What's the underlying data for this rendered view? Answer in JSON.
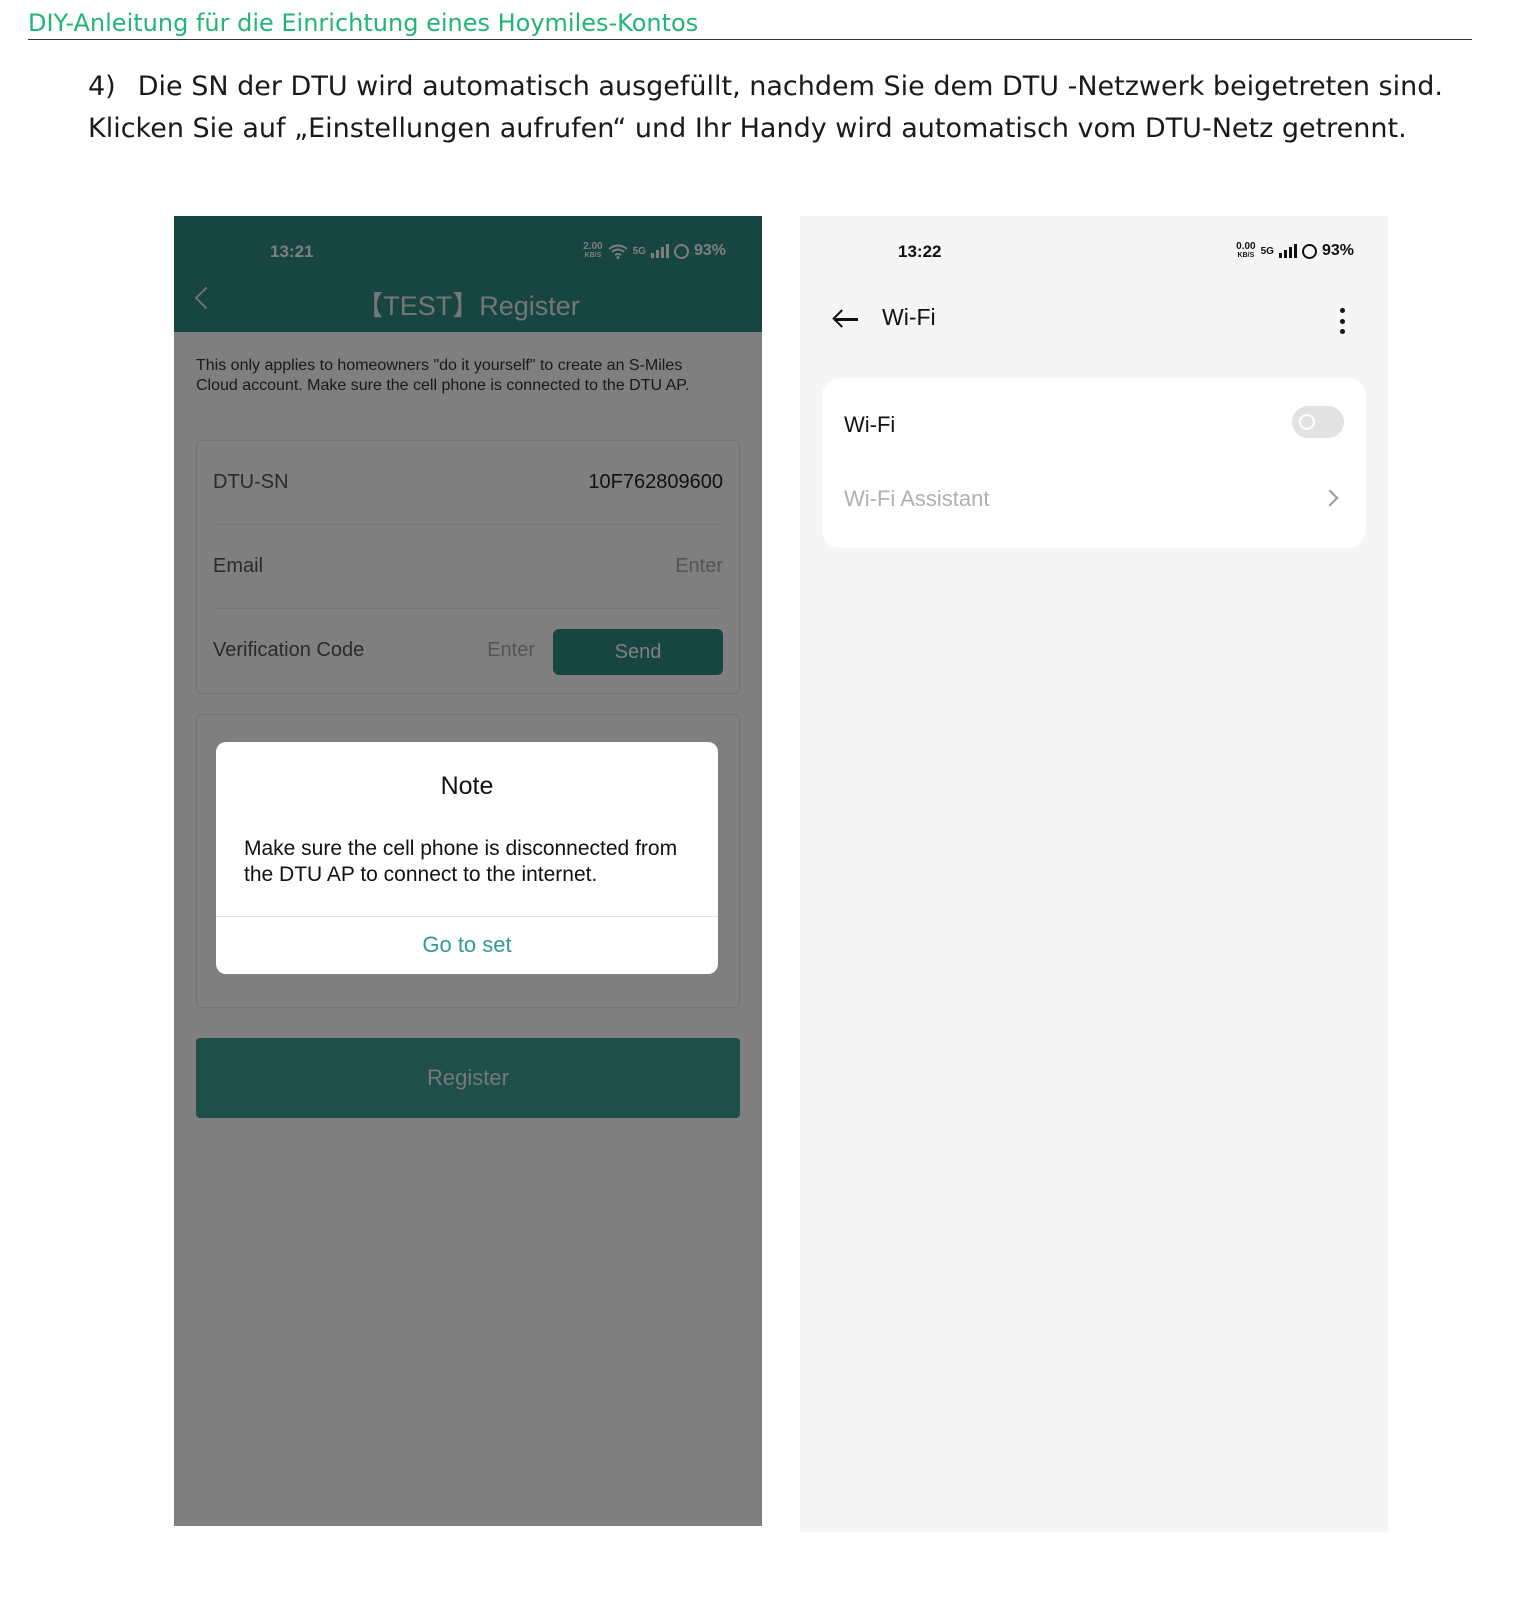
{
  "document": {
    "header": "DIY-Anleitung für die Einrichtung eines Hoymiles-Kontos",
    "step_number": "4)",
    "step_text": "Die SN der DTU wird automatisch ausgefüllt, nachdem Sie dem DTU -Netzwerk beigetreten sind. Klicken Sie auf „Einstellungen aufrufen“ und Ihr Handy wird automatisch vom DTU-Netz getrennt."
  },
  "left_phone": {
    "status": {
      "time": "13:21",
      "speed": "2.00",
      "speed_unit": "KB/S",
      "network": "5G",
      "battery": "93%"
    },
    "title": "【TEST】Register",
    "intro": "This only applies to homeowners \"do it yourself\" to create an S-Miles Cloud account. Make sure the cell phone is connected to the DTU AP.",
    "form": {
      "dtu_sn_label": "DTU-SN",
      "dtu_sn_value": "10F762809600",
      "email_label": "Email",
      "email_placeholder": "Enter",
      "code_label": "Verification Code",
      "code_placeholder": "Enter",
      "send_label": "Send"
    },
    "register_label": "Register",
    "dialog": {
      "title": "Note",
      "message": "Make sure the cell phone is disconnected from the DTU AP to connect to the internet.",
      "button": "Go to set"
    }
  },
  "right_phone": {
    "status": {
      "time": "13:22",
      "speed": "0.00",
      "speed_unit": "KB/S",
      "network": "5G",
      "battery": "93%"
    },
    "title": "Wi-Fi",
    "wifi_label": "Wi-Fi",
    "wifi_enabled": false,
    "assistant_label": "Wi-Fi Assistant"
  },
  "colors": {
    "header_green": "#22b573",
    "app_teal": "#2f8a83",
    "link_teal": "#2f9c93"
  },
  "icons": [
    "back-chevron-icon",
    "wifi-icon",
    "signal-icon",
    "battery-icon",
    "back-arrow-icon",
    "more-vertical-icon",
    "chevron-right-icon"
  ]
}
